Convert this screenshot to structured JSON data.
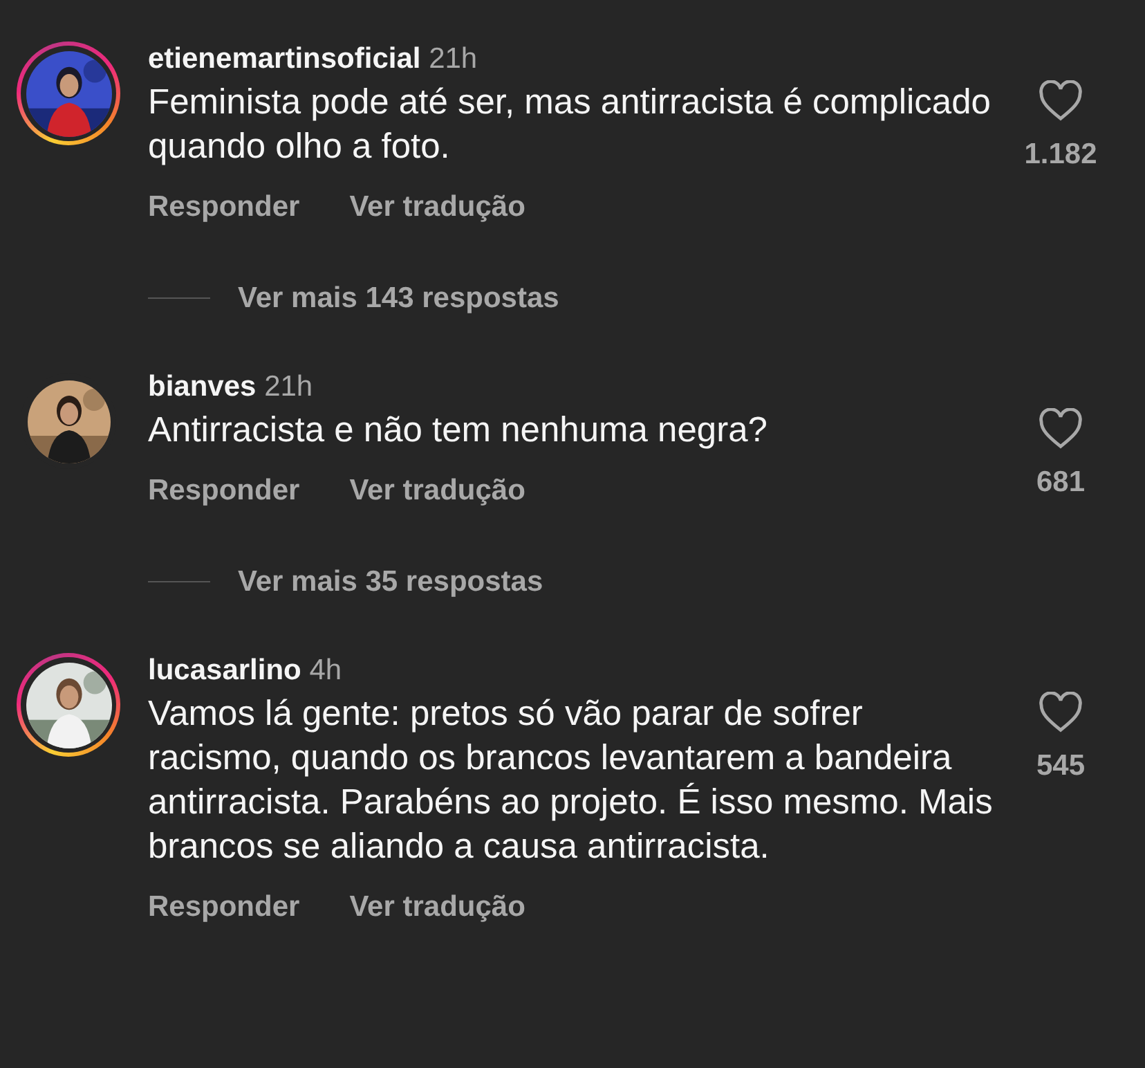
{
  "comments": [
    {
      "username": "etienemartinsoficial",
      "time": "21h",
      "text": "Feminista pode até ser, mas antirracista é complicado quando olho a foto.",
      "liked": false,
      "likes": "1.182",
      "has_story": true,
      "avatar": {
        "kind": "picture"
      },
      "actions": [
        "Responder",
        "Ver tradução"
      ],
      "replies_link": "Ver mais 143 respostas"
    },
    {
      "username": "bianves",
      "time": "21h",
      "text": "Antirracista e não tem nenhuma negra?",
      "liked": false,
      "likes": "681",
      "has_story": false,
      "avatar": {
        "kind": "picture"
      },
      "actions": [
        "Responder",
        "Ver tradução"
      ],
      "replies_link": "Ver mais 35 respostas"
    },
    {
      "username": "lucasarlino",
      "time": "4h",
      "text": "Vamos lá gente: pretos só vão parar de sofrer racismo, quando os brancos levantarem a bandeira antirracista. Parabéns ao projeto. É isso mesmo. Mais brancos se aliando a causa antirracista.",
      "liked": false,
      "likes": "545",
      "has_story": true,
      "avatar": {
        "kind": "picture"
      },
      "actions": [
        "Responder",
        "Ver tradução"
      ]
    }
  ]
}
